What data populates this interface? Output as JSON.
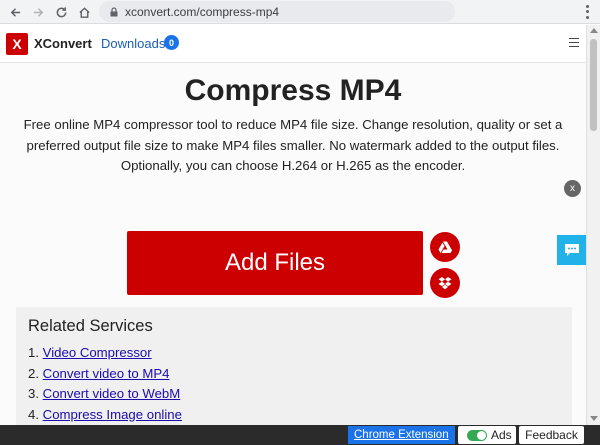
{
  "browser": {
    "url": "xconvert.com/compress-mp4"
  },
  "header": {
    "logo_letter": "X",
    "brand": "XConvert",
    "downloads_label": "Downloads",
    "downloads_count": "0"
  },
  "main": {
    "title": "Compress MP4",
    "description": "Free online MP4 compressor tool to reduce MP4 file size. Change resolution, quality or set a preferred output file size to make MP4 files smaller. No watermark added to the output files. Optionally, you can choose H.264 or H.265 as the encoder.",
    "close_label": "x",
    "add_files_label": "Add Files"
  },
  "related": {
    "title": "Related Services",
    "items": [
      {
        "num": "1.",
        "label": "Video Compressor"
      },
      {
        "num": "2.",
        "label": "Convert video to MP4"
      },
      {
        "num": "3.",
        "label": "Convert video to WebM"
      },
      {
        "num": "4.",
        "label": "Compress Image online"
      }
    ]
  },
  "footer": {
    "extension_label": "Chrome Extension",
    "ads_label": "Ads",
    "feedback_label": "Feedback"
  },
  "colors": {
    "brand_red": "#cc0000",
    "link_blue": "#1a0dab",
    "chat_cyan": "#20b2e8",
    "toggle_green": "#34a853"
  },
  "icons": {
    "back": "arrow-left-icon",
    "forward": "arrow-right-icon",
    "reload": "reload-icon",
    "home": "home-icon",
    "lock": "lock-icon",
    "menu": "hamburger-icon",
    "gdrive": "google-drive-icon",
    "dropbox": "dropbox-icon",
    "chat": "chat-icon"
  }
}
